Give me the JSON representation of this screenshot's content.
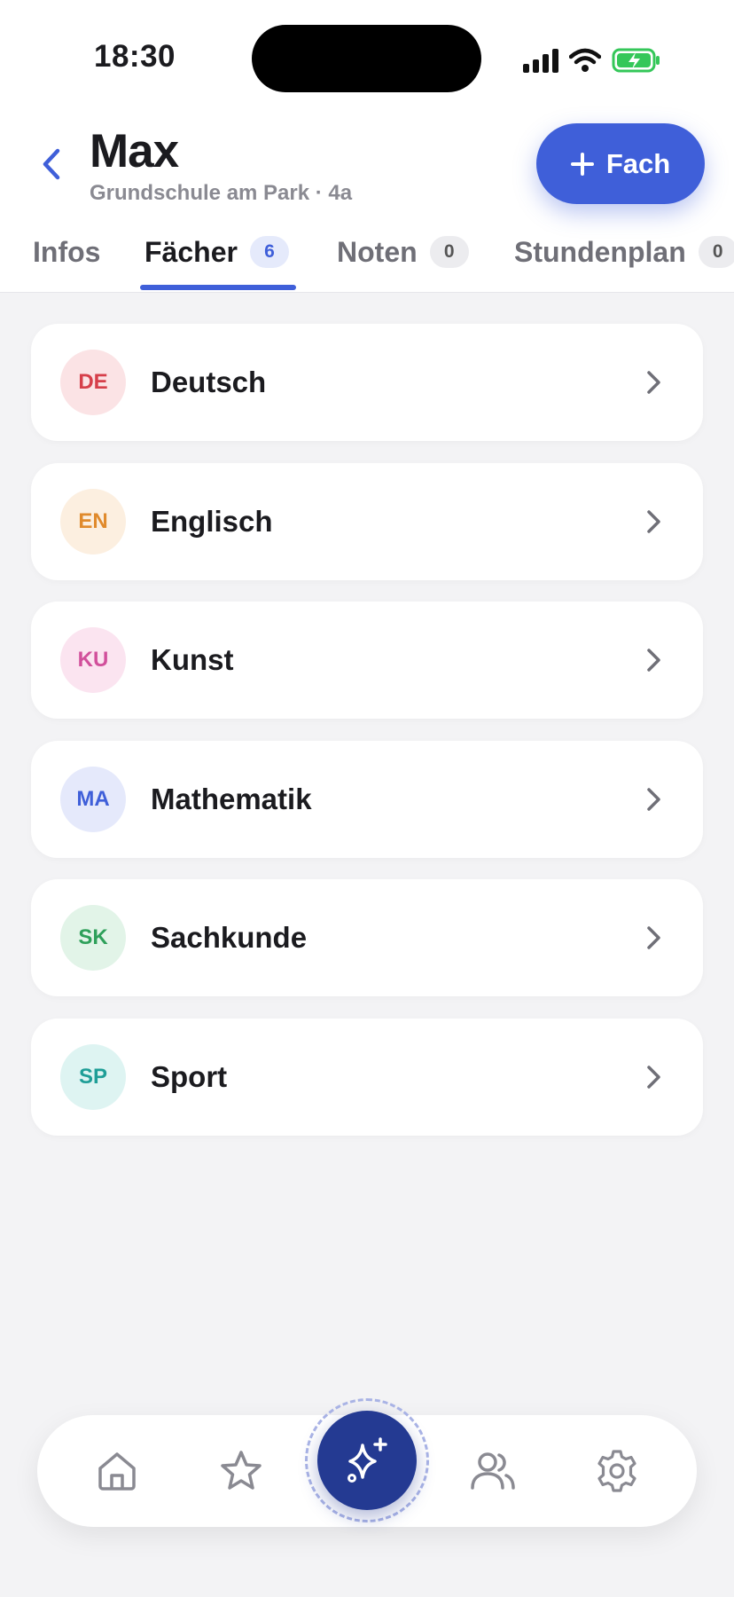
{
  "status_bar": {
    "time": "18:30"
  },
  "header": {
    "title": "Max",
    "subtitle": "Grundschule am Park · 4a",
    "add_button_label": "Fach"
  },
  "tabs": [
    {
      "label": "Infos",
      "badge": null,
      "active": false
    },
    {
      "label": "Fächer",
      "badge": "6",
      "active": true
    },
    {
      "label": "Noten",
      "badge": "0",
      "active": false
    },
    {
      "label": "Stundenplan",
      "badge": "0",
      "active": false
    }
  ],
  "subjects": [
    {
      "code": "DE",
      "name": "Deutsch",
      "color": "#d63f4a",
      "bg": "#fbe3e5"
    },
    {
      "code": "EN",
      "name": "Englisch",
      "color": "#e08a2c",
      "bg": "#fcefe0"
    },
    {
      "code": "KU",
      "name": "Kunst",
      "color": "#d14f9b",
      "bg": "#fbe4f0"
    },
    {
      "code": "MA",
      "name": "Mathematik",
      "color": "#3f5fd9",
      "bg": "#e5e9fb"
    },
    {
      "code": "SK",
      "name": "Sachkunde",
      "color": "#2ea05a",
      "bg": "#e2f4e8"
    },
    {
      "code": "SP",
      "name": "Sport",
      "color": "#1f9e97",
      "bg": "#def4f2"
    }
  ],
  "nav": {
    "items": [
      "home-icon",
      "star-icon",
      "sparkles-icon",
      "users-icon",
      "gear-icon"
    ],
    "active": "sparkles-icon"
  },
  "colors": {
    "accent": "#3f5fd9",
    "fab": "#243a92",
    "battery": "#34c759"
  }
}
